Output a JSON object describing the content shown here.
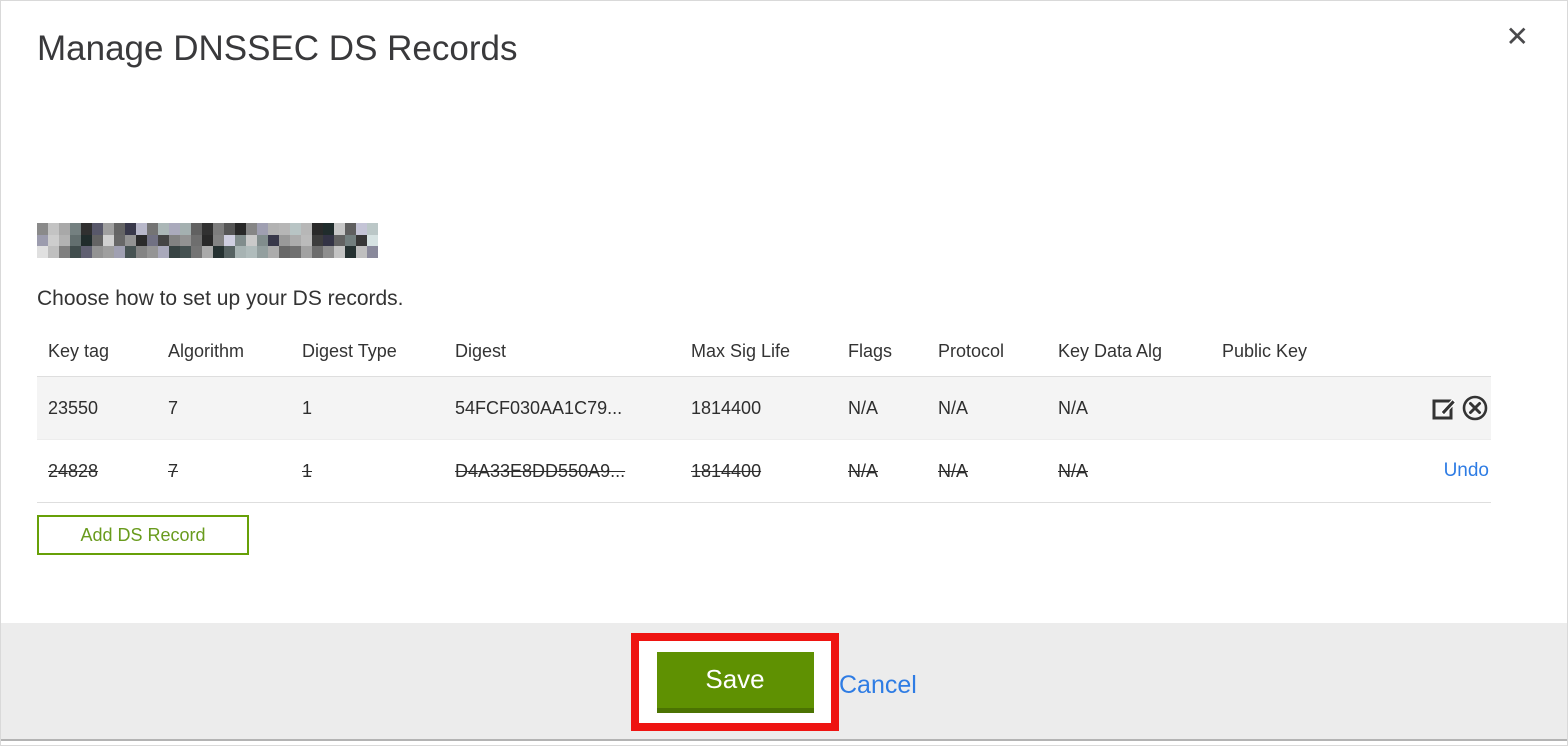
{
  "modal": {
    "title": "Manage DNSSEC DS Records",
    "close_icon": "close-x",
    "subtitle": "Choose how to set up your DS records.",
    "domain": "(redacted)"
  },
  "table": {
    "headers": [
      "Key tag",
      "Algorithm",
      "Digest Type",
      "Digest",
      "Max Sig Life",
      "Flags",
      "Protocol",
      "Key Data Alg",
      "Public Key"
    ],
    "rows": [
      {
        "key_tag": "23550",
        "algorithm": "7",
        "digest_type": "1",
        "digest": "54FCF030AA1C79...",
        "max_sig_life": "1814400",
        "flags": "N/A",
        "protocol": "N/A",
        "key_data_alg": "N/A",
        "public_key": "",
        "state": "normal",
        "actions": [
          "edit-icon",
          "delete-icon"
        ]
      },
      {
        "key_tag": "24828",
        "algorithm": "7",
        "digest_type": "1",
        "digest": "D4A33E8DD550A9...",
        "max_sig_life": "1814400",
        "flags": "N/A",
        "protocol": "N/A",
        "key_data_alg": "N/A",
        "public_key": "",
        "state": "deleted",
        "undo_label": "Undo"
      }
    ]
  },
  "buttons": {
    "add_ds_record": "Add DS Record",
    "save": "Save",
    "cancel": "Cancel"
  },
  "colors": {
    "button_green": "#5f9102",
    "button_green_shadow": "#4b7302",
    "outline_green": "#67a008",
    "link_blue": "#2e7ce4",
    "annotation_red": "#ee1411",
    "row_stripe": "#f4f4f4",
    "footer_gray": "#ececec"
  }
}
